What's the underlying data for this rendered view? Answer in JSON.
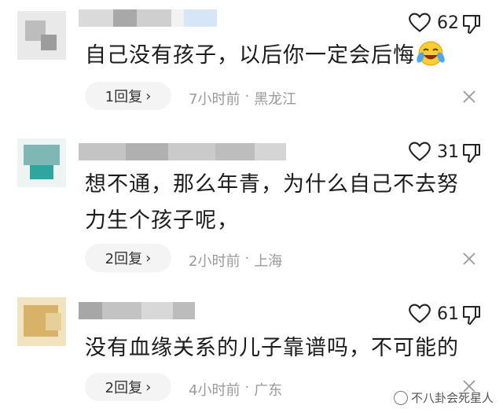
{
  "comments": [
    {
      "likes": "62",
      "text": "自己没有孩子，以后你一定会后悔",
      "emoji": "laughing-crying-emoji",
      "reply_label": "1回复",
      "time": "7小时前",
      "sep": "·",
      "location": "黑龙江"
    },
    {
      "likes": "31",
      "text": "想不通，那么年青，为什么自己不去努力生个孩子呢，",
      "reply_label": "2回复",
      "time": "2小时前",
      "sep": "·",
      "location": "上海"
    },
    {
      "likes": "61",
      "text": "没有血缘关系的儿子靠谱吗，不可能的",
      "reply_label": "2回复",
      "time": "4小时前",
      "sep": "·",
      "location": "广东"
    }
  ],
  "watermark": "不八卦会死星人",
  "colors": {
    "meta": "#9a9a9a",
    "reply_bg": "#f4f4f4"
  }
}
